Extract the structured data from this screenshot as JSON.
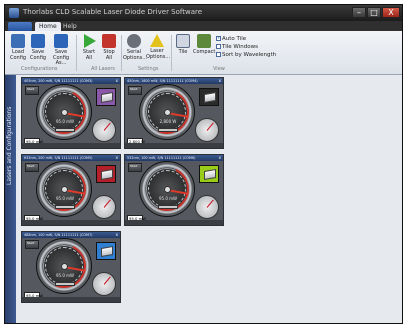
{
  "window": {
    "title": "Thorlabs CLD Scalable Laser Diode Driver Software",
    "buttons": {
      "minimize": "–",
      "maximize": "□",
      "close": "X"
    }
  },
  "ribbon": {
    "tabs": [
      "Home",
      "Help"
    ],
    "buttons": [
      {
        "id": "load",
        "label": "Load\nConfig",
        "icon": "load-config-icon",
        "color": "#3c6fb6"
      },
      {
        "id": "save",
        "label": "Save\nConfig",
        "icon": "save-config-icon",
        "color": "#2d66b8"
      },
      {
        "id": "saveas",
        "label": "Save\nConfig As...",
        "icon": "save-config-as-icon",
        "color": "#2d66b8"
      },
      {
        "id": "startall",
        "label": "Start\nAll",
        "icon": "play-icon",
        "color": "#38a83a"
      },
      {
        "id": "stopall",
        "label": "Stop\nAll",
        "icon": "stop-icon",
        "color": "#c3342c"
      },
      {
        "id": "serial",
        "label": "Serial\nOptions...",
        "icon": "serial-options-icon",
        "color": "#6a6f78"
      },
      {
        "id": "laser",
        "label": "Laser\nOptions...",
        "icon": "laser-warning-icon",
        "color": "#e3c21d"
      },
      {
        "id": "tile",
        "label": "Tile",
        "icon": "tile-icon",
        "color": "#cfd6e2"
      },
      {
        "id": "compact",
        "label": "Compact",
        "icon": "compact-icon",
        "color": "#5d8a3a"
      }
    ],
    "groups": [
      "Configurations",
      "All Lasers",
      "Settings",
      "View"
    ],
    "checkboxes": [
      {
        "label": "Auto Tile",
        "checked": true
      },
      {
        "label": "Tile Windows",
        "checked": false
      },
      {
        "label": "Sort by Wavelength",
        "checked": false
      }
    ]
  },
  "sidebar": {
    "label": "Lasers and Configurations"
  },
  "panels": [
    {
      "title": "405nm, 200 mW, S/N 11111111 (COM3)",
      "readout": "95.0 mW",
      "power": "95.0 mW",
      "icon_color": "#8a58a8",
      "button": "Start"
    },
    {
      "title": "450nm, 1600 mW, S/N 11111111 (COM4)",
      "readout": "2,800 W",
      "power": "2,800 W",
      "icon_color": "#2a2a2a",
      "button": "Start"
    },
    {
      "title": "635nm, 200 mW, S/N 11111111 (COM5)",
      "readout": "95.0 mW",
      "power": "95.0 mW",
      "icon_color": "#b3202a",
      "button": "Start"
    },
    {
      "title": "532nm, 100 mW, S/N 11111111 (COM6)",
      "readout": "95.0 mW",
      "power": "95.0 mW",
      "icon_color": "#9acc1a",
      "button": "Start"
    },
    {
      "title": "488nm, 100 mW, S/N 11111111 (COM7)",
      "readout": "95.0 mW",
      "power": "95.0 mW",
      "icon_color": "#2f7fd2",
      "button": "Start"
    }
  ]
}
